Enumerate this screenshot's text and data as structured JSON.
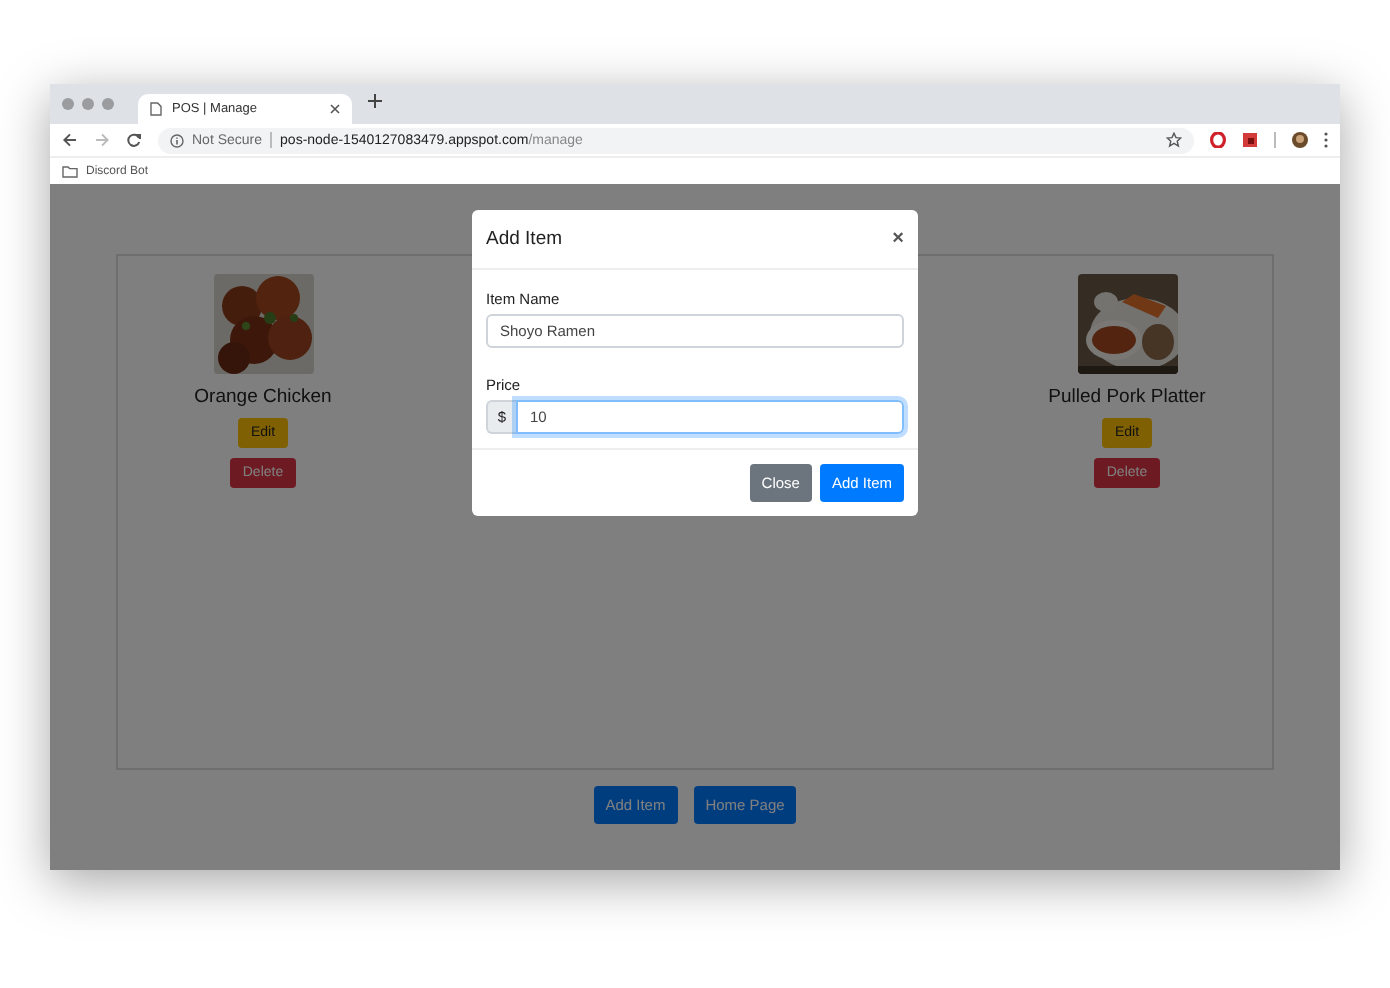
{
  "browser": {
    "tab": {
      "title": "POS | Manage"
    },
    "address": {
      "security": "Not Secure",
      "host": "pos-node-1540127083479.appspot.com",
      "path": "/manage"
    },
    "bookmarks": [
      {
        "label": "Discord Bot"
      }
    ]
  },
  "menu_items": [
    {
      "name": "Orange Chicken",
      "edit": "Edit",
      "delete": "Delete"
    },
    {
      "name": "Pulled Pork Platter",
      "edit": "Edit",
      "delete": "Delete"
    }
  ],
  "page_buttons": [
    {
      "label": "Add Item",
      "kind": "primary"
    },
    {
      "label": "Home Page",
      "kind": "primary"
    }
  ],
  "modal": {
    "title": "Add Item",
    "close": "×",
    "fields": [
      {
        "label": "Item Name",
        "value": "Shoyo Ramen",
        "focused": false
      },
      {
        "label": "Price",
        "prefix": "$",
        "value": "10",
        "focused": true
      }
    ],
    "buttons": [
      {
        "label": "Close",
        "kind": "secondary"
      },
      {
        "label": "Add Item",
        "kind": "primary"
      }
    ]
  }
}
